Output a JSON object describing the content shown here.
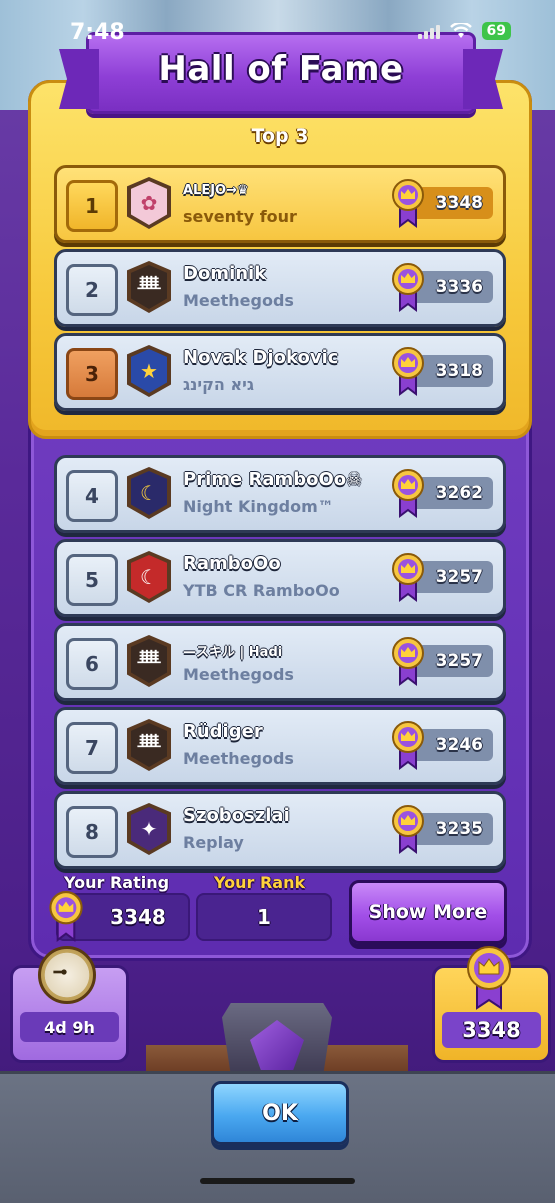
{
  "status_bar": {
    "time": "7:48",
    "battery": "69"
  },
  "header": {
    "title": "Hall of Fame",
    "section_title": "Top 3"
  },
  "leaderboard": [
    {
      "rank": "1",
      "name": "ALEJO→♛",
      "clan": "seventy four",
      "rating": "3348",
      "tier": "gold",
      "badge_color": "#f3c9d8",
      "badge_symbol": "✿"
    },
    {
      "rank": "2",
      "name": "Dominik",
      "clan": "Meethegods",
      "rating": "3336",
      "tier": "silver",
      "badge_color": "#3a2a22",
      "badge_symbol": "ᚙ"
    },
    {
      "rank": "3",
      "name": "Novak Djokovic",
      "clan": "גיא הקינג",
      "rating": "3318",
      "tier": "bronze",
      "badge_color": "#2a4aa8",
      "badge_symbol": "★"
    },
    {
      "rank": "4",
      "name": "Prime RamboOo☠",
      "clan": "Night Kingdom™",
      "rating": "3262",
      "tier": "plain",
      "badge_color": "#2a2a6a",
      "badge_symbol": "☾"
    },
    {
      "rank": "5",
      "name": "RamboOo",
      "clan": "YTB CR RamboOo",
      "rating": "3257",
      "tier": "plain",
      "badge_color": "#c42a2a",
      "badge_symbol": "☾"
    },
    {
      "rank": "6",
      "name": "—スキル | Hadi",
      "clan": "Meethegods",
      "rating": "3257",
      "tier": "plain",
      "badge_color": "#3a2a22",
      "badge_symbol": "ᚙ"
    },
    {
      "rank": "7",
      "name": "Rüdiger",
      "clan": "Meethegods",
      "rating": "3246",
      "tier": "plain",
      "badge_color": "#3a2a22",
      "badge_symbol": "ᚙ"
    },
    {
      "rank": "8",
      "name": "Szoboszlai",
      "clan": "Replay",
      "rating": "3235",
      "tier": "plain",
      "badge_color": "#4a2a7a",
      "badge_symbol": "✦"
    }
  ],
  "footer": {
    "your_rating_label": "Your Rating",
    "your_rating_value": "3348",
    "your_rank_label": "Your Rank",
    "your_rank_value": "1",
    "show_more_label": "Show More"
  },
  "bottom": {
    "timer_value": "4d 9h",
    "rating_value": "3348",
    "ok_label": "OK"
  },
  "colors": {
    "accent": "#a24fe8",
    "gold": "#f7c640",
    "ok_blue": "#4aa8f0"
  },
  "icons": {
    "medal": "crown-medal-icon",
    "clock": "stopwatch-icon"
  }
}
